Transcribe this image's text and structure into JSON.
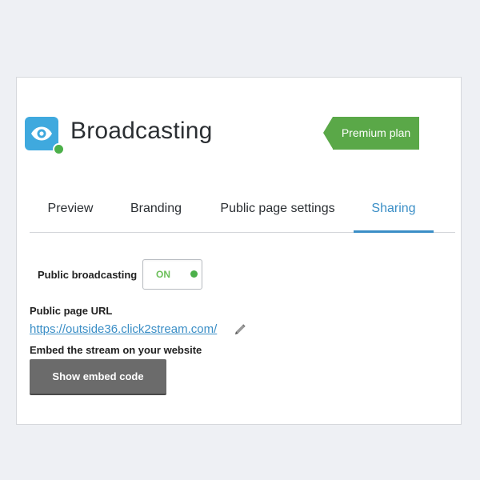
{
  "header": {
    "title": "Broadcasting",
    "app_icon": "eye-icon",
    "status_color": "#4cb04a",
    "plan_badge": "Premium plan",
    "plan_badge_color": "#5aa848"
  },
  "tabs": [
    {
      "label": "Preview",
      "active": false
    },
    {
      "label": "Branding",
      "active": false
    },
    {
      "label": "Public page settings",
      "active": false
    },
    {
      "label": "Sharing",
      "active": true
    }
  ],
  "sharing": {
    "public_broadcasting_label": "Public broadcasting",
    "toggle_state": "ON",
    "public_url_label": "Public page URL",
    "public_url": "https://outside36.click2stream.com/",
    "edit_icon": "pencil-icon",
    "embed_label": "Embed the stream on your website",
    "embed_button": "Show embed code"
  },
  "colors": {
    "accent": "#3a8ec6",
    "toggle_on": "#6bbf59"
  }
}
